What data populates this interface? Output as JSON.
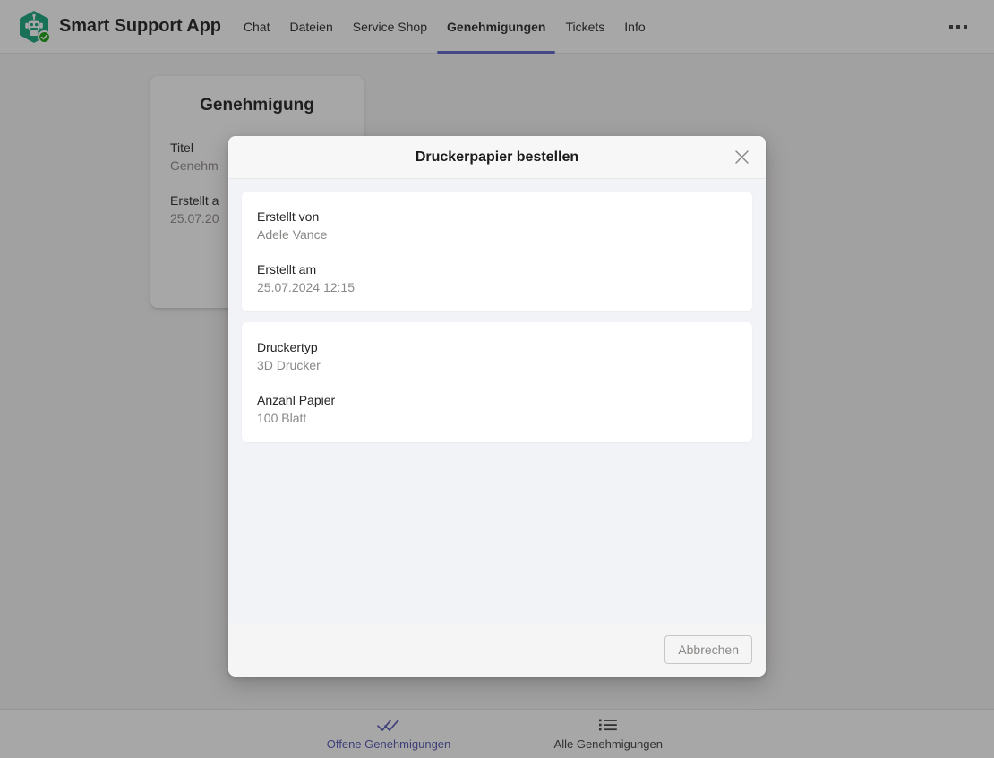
{
  "header": {
    "app_title": "Smart Support App",
    "logo_icon": "robot-hexagon-icon",
    "badge_icon": "check-badge-icon",
    "overflow_icon": "more-options-icon",
    "tabs": [
      {
        "label": "Chat",
        "active": false
      },
      {
        "label": "Dateien",
        "active": false
      },
      {
        "label": "Service Shop",
        "active": false
      },
      {
        "label": "Genehmigungen",
        "active": true
      },
      {
        "label": "Tickets",
        "active": false
      },
      {
        "label": "Info",
        "active": false
      }
    ]
  },
  "background_card": {
    "heading": "Genehmigung",
    "fields": [
      {
        "label": "Titel",
        "value": "Genehm"
      },
      {
        "label": "Erstellt a",
        "value": "25.07.20"
      }
    ]
  },
  "dialog": {
    "title": "Druckerpapier bestellen",
    "close_icon": "close-icon",
    "cards": [
      {
        "fields": [
          {
            "label": "Erstellt von",
            "value": "Adele Vance"
          },
          {
            "label": "Erstellt am",
            "value": "25.07.2024 12:15"
          }
        ]
      },
      {
        "fields": [
          {
            "label": "Druckertyp",
            "value": "3D Drucker"
          },
          {
            "label": "Anzahl Papier",
            "value": "100 Blatt"
          }
        ]
      }
    ],
    "cancel_label": "Abbrechen"
  },
  "bottom_nav": {
    "items": [
      {
        "label": "Offene Genehmigungen",
        "icon": "double-check-icon",
        "active": true
      },
      {
        "label": "Alle Genehmigungen",
        "icon": "list-icon",
        "active": false
      }
    ]
  },
  "colors": {
    "accent": "#5b5fc7",
    "accent_active_nav": "#4f52b2",
    "logo_green": "#13a10e",
    "logo_hex": "#0b9b75",
    "dialog_body": "#f2f3f7",
    "overlay": "#9a9a9a",
    "muted_text": "#8a8886"
  }
}
